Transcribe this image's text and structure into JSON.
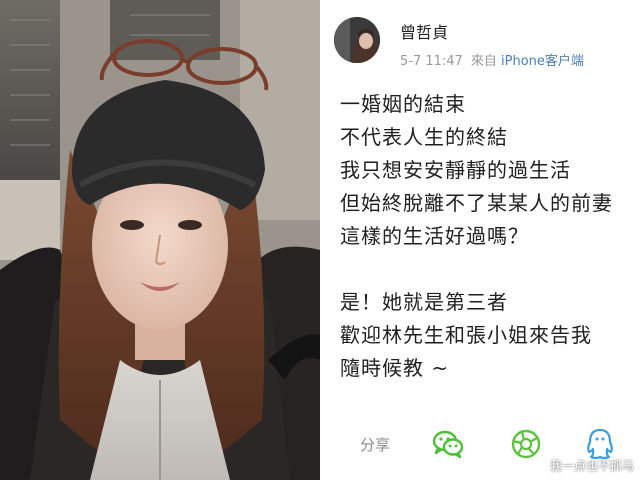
{
  "profile": {
    "username": "曾哲貞",
    "date_time": "5-7 11:47",
    "source_prefix": "來自",
    "source_name": "iPhone客户端"
  },
  "post": {
    "lines": [
      "一婚姻的結束",
      "不代表人生的終結",
      "我只想安安靜靜的過生活",
      "但始終脫離不了某某人的前妻",
      "這樣的生活好過嗎？",
      "",
      "是！她就是第三者",
      "歡迎林先生和張小姐來告我",
      "隨時候教 ~"
    ]
  },
  "actions": {
    "share_label": "分享",
    "icons": [
      "wechat-icon",
      "moments-icon",
      "qq-icon"
    ]
  },
  "watermark": "我一点也不抓马",
  "colors": {
    "wechat": "#4cbe3a",
    "moments": "#5ac43c",
    "qq": "#3a9fdc",
    "source_link": "#4d7fb8"
  }
}
